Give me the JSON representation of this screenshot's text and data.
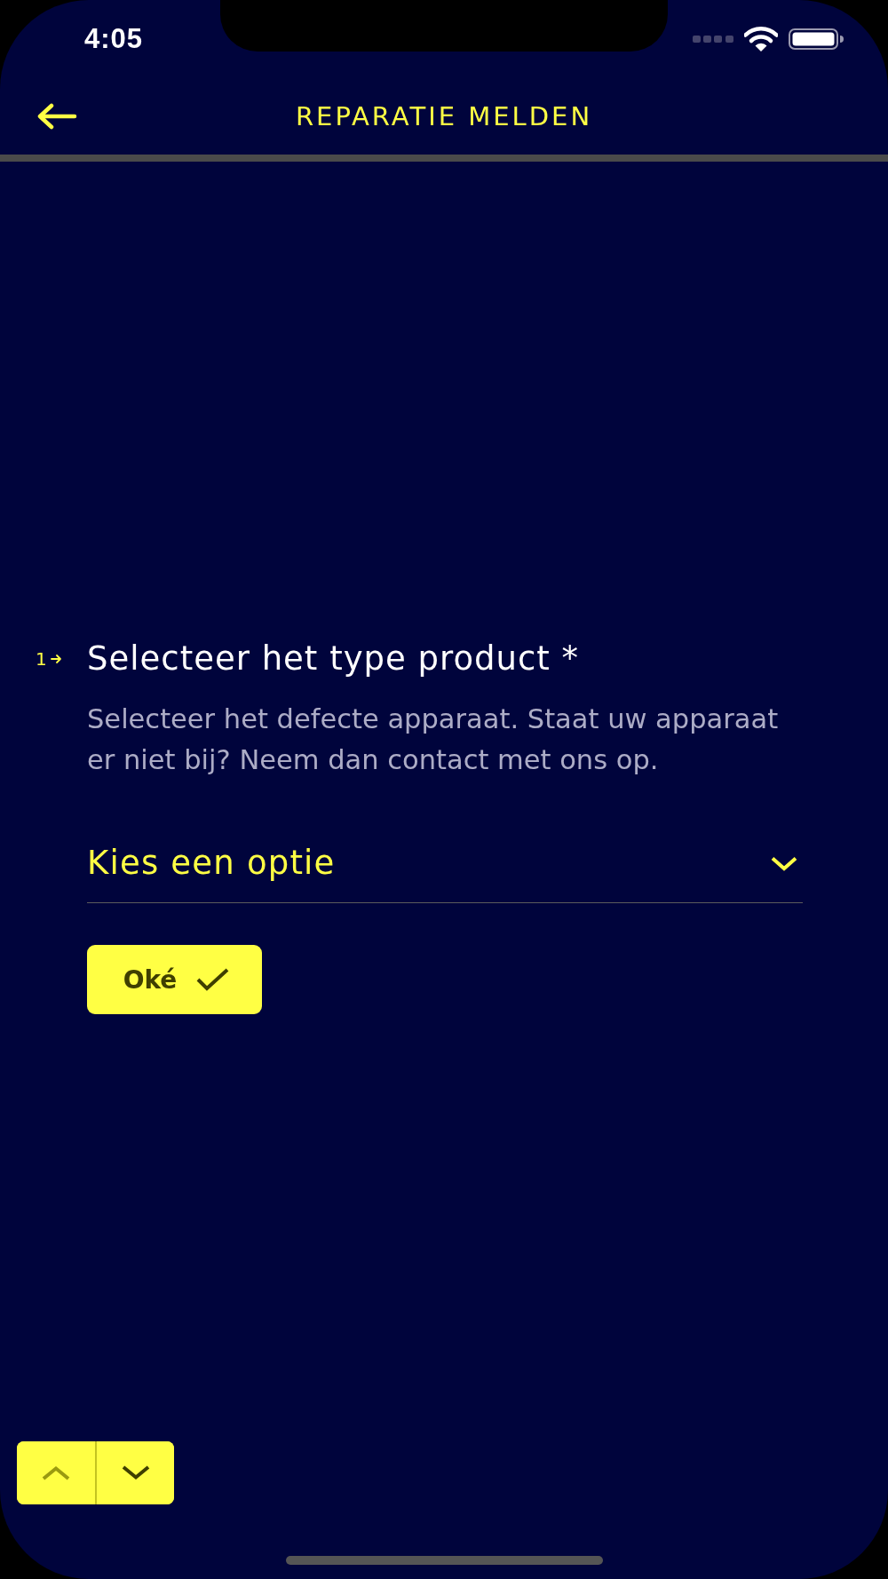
{
  "status_bar": {
    "time": "4:05"
  },
  "header": {
    "title": "REPARATIE MELDEN"
  },
  "question": {
    "number": "1",
    "title": "Selecteer het type product *",
    "description": "Selecteer het defecte apparaat. Staat uw apparaat er niet bij? Neem dan contact met ons op.",
    "select": {
      "placeholder": "Kies een optie"
    },
    "button": {
      "label": "Oké"
    }
  },
  "nav_buttons": [
    {
      "kind": "up",
      "disabled": true
    },
    {
      "kind": "down",
      "disabled": false
    }
  ]
}
